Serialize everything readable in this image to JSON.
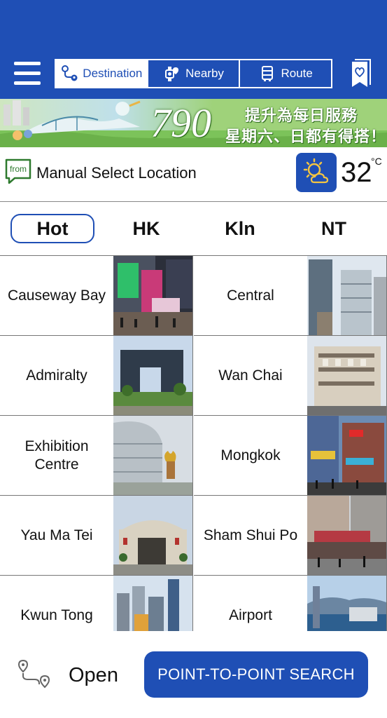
{
  "header": {
    "tabs": [
      {
        "label": "Destination",
        "icon": "destination-icon",
        "active": true
      },
      {
        "label": "Nearby",
        "icon": "nearby-icon",
        "active": false
      },
      {
        "label": "Route",
        "icon": "bus-icon",
        "active": false
      }
    ],
    "menu_icon": "hamburger-menu-icon",
    "bookmark_icon": "bookmark-heart-icon"
  },
  "banner": {
    "route_number": "790",
    "line1": "提升為每日服務",
    "line2": "星期六、日都有得搭！"
  },
  "location": {
    "from_badge": "from",
    "label": "Manual Select Location",
    "weather_icon": "sun-cloud-icon",
    "temperature": "32",
    "unit": "°C"
  },
  "regions": [
    {
      "label": "Hot",
      "active": true
    },
    {
      "label": "HK",
      "active": false
    },
    {
      "label": "Kln",
      "active": false
    },
    {
      "label": "NT",
      "active": false
    }
  ],
  "places": [
    {
      "name": "Causeway Bay"
    },
    {
      "name": "Central"
    },
    {
      "name": "Admiralty"
    },
    {
      "name": "Wan Chai"
    },
    {
      "name": "Exhibition Centre"
    },
    {
      "name": "Mongkok"
    },
    {
      "name": "Yau Ma Tei"
    },
    {
      "name": "Sham Shui Po"
    },
    {
      "name": "Kwun Tong"
    },
    {
      "name": "Airport"
    }
  ],
  "bottom": {
    "open_label": "Open",
    "open_icon": "route-pins-icon",
    "search_button": "POINT-TO-POINT SEARCH"
  },
  "colors": {
    "brand_blue": "#1f4fb5",
    "banner_green": "#9fd27a"
  }
}
